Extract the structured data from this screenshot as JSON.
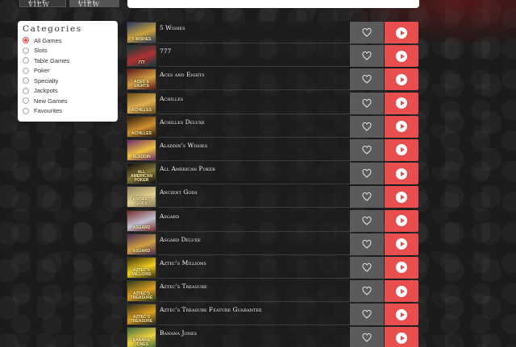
{
  "view_tabs": {
    "grid": "Tile View",
    "list": "List View"
  },
  "sidebar": {
    "heading": "Categories",
    "items": [
      {
        "label": "All Games",
        "checked": true
      },
      {
        "label": "Slots",
        "checked": false
      },
      {
        "label": "Table Games",
        "checked": false
      },
      {
        "label": "Poker",
        "checked": false
      },
      {
        "label": "Specialty",
        "checked": false
      },
      {
        "label": "Jackpots",
        "checked": false
      },
      {
        "label": "New Games",
        "checked": false
      },
      {
        "label": "Favourites",
        "checked": false
      }
    ]
  },
  "games": [
    {
      "title": "5 Wishes",
      "thumb_colors": [
        "#2a3a6a",
        "#c9a23a"
      ],
      "thumb_text": "5 WISHES"
    },
    {
      "title": "777",
      "thumb_colors": [
        "#0e3b3b",
        "#b03030"
      ],
      "thumb_text": "777"
    },
    {
      "title": "Aces and Eights",
      "thumb_colors": [
        "#5a1818",
        "#d4a040"
      ],
      "thumb_text": "ACES & EIGHTS"
    },
    {
      "title": "Achilles",
      "thumb_colors": [
        "#6a4a1a",
        "#e0b050"
      ],
      "thumb_text": "ACHILLES"
    },
    {
      "title": "Achilles Deluxe",
      "thumb_colors": [
        "#2a1a0a",
        "#d09030"
      ],
      "thumb_text": "ACHILLES"
    },
    {
      "title": "Aladdin's Wishes",
      "thumb_colors": [
        "#6a2a6a",
        "#f0c040"
      ],
      "thumb_text": "ALADDIN"
    },
    {
      "title": "All American Poker",
      "thumb_colors": [
        "#0a0a0a",
        "#8a7a3a"
      ],
      "thumb_text": "ALL AMERICAN POKER"
    },
    {
      "title": "Ancient Gods",
      "thumb_colors": [
        "#8a7a5a",
        "#e0d090"
      ],
      "thumb_text": "ANCIENT GODS"
    },
    {
      "title": "Asgard",
      "thumb_colors": [
        "#7a2a2a",
        "#c0c0d0"
      ],
      "thumb_text": "ASGARD"
    },
    {
      "title": "Asgard Deluxe",
      "thumb_colors": [
        "#4a2a5a",
        "#d0a040"
      ],
      "thumb_text": "ASGARD"
    },
    {
      "title": "Aztec's Millions",
      "thumb_colors": [
        "#3a2a0a",
        "#f0d020"
      ],
      "thumb_text": "AZTEC'S MILLIONS"
    },
    {
      "title": "Aztec's Treasure",
      "thumb_colors": [
        "#2a3a1a",
        "#e0a020"
      ],
      "thumb_text": "AZTEC'S TREASURE"
    },
    {
      "title": "Aztec's Treasure Feature Guarantee",
      "thumb_colors": [
        "#2a2a1a",
        "#e0a020"
      ],
      "thumb_text": "AZTEC'S TREASURE"
    },
    {
      "title": "Banana Jones",
      "thumb_colors": [
        "#3a6a3a",
        "#f0d040"
      ],
      "thumb_text": "BANANA JONES"
    }
  ],
  "icons": {
    "favourite": "heart-icon",
    "play": "play-icon"
  },
  "colors": {
    "play_button": "#e94e4e",
    "fav_button": "#5b5b5b",
    "accent_radio": "#e05252"
  }
}
